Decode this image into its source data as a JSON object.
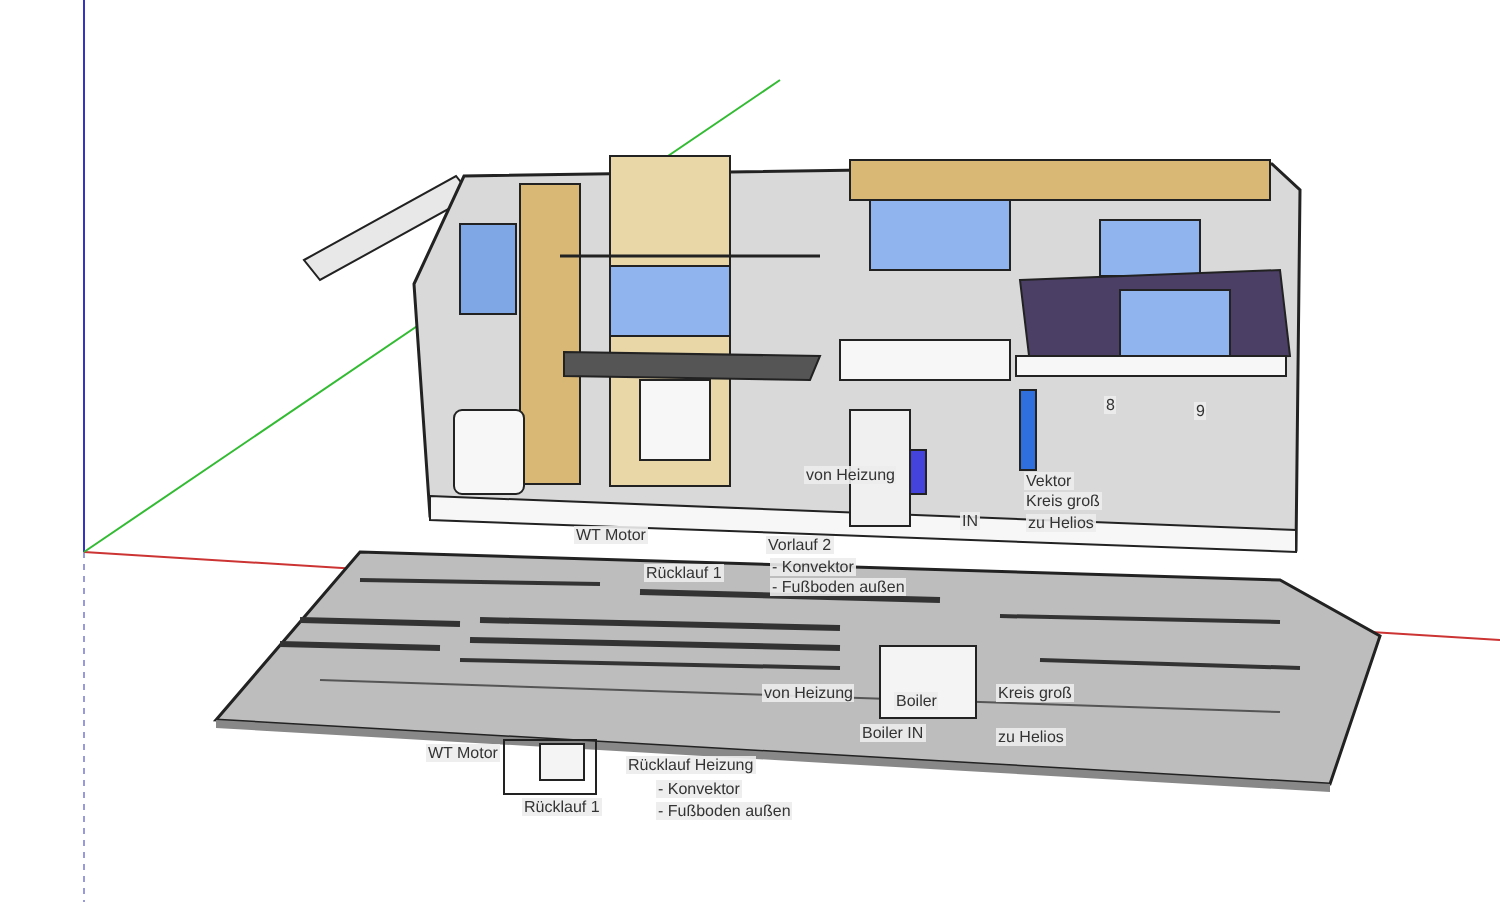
{
  "labels": [
    {
      "text": "von Heizung"
    },
    {
      "text": "Vektor"
    },
    {
      "text": "Kreis groß"
    },
    {
      "text": "zu Helios"
    },
    {
      "text": "IN"
    },
    {
      "text": "8"
    },
    {
      "text": "9"
    },
    {
      "text": "WT Motor"
    },
    {
      "text": "Vorlauf 2"
    },
    {
      "text": "- Konvektor"
    },
    {
      "text": "- Fußboden außen"
    },
    {
      "text": "Rücklauf 1"
    },
    {
      "text": "von Heizung"
    },
    {
      "text": "Boiler"
    },
    {
      "text": "Boiler IN"
    },
    {
      "text": "Kreis groß"
    },
    {
      "text": "zu Helios"
    },
    {
      "text": "WT Motor"
    },
    {
      "text": "Rücklauf 1"
    },
    {
      "text": "Rücklauf Heizung"
    },
    {
      "text": "- Konvektor"
    },
    {
      "text": "- Fußboden außen"
    }
  ]
}
